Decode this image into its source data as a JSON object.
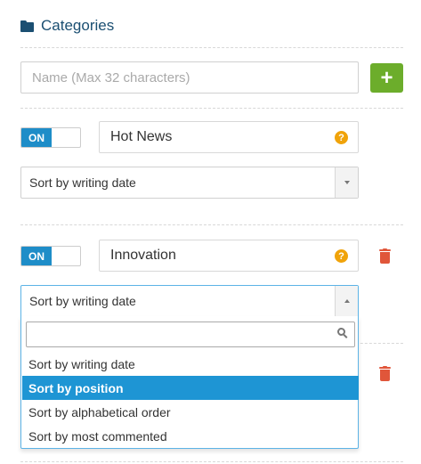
{
  "header": {
    "title": "Categories",
    "icon": "folder-icon"
  },
  "new_category": {
    "placeholder": "Name (Max 32 characters)",
    "add_label": "+"
  },
  "categories": [
    {
      "toggle": "ON",
      "name": "Hot News",
      "help": "?",
      "sort": "Sort by writing date"
    },
    {
      "toggle": "ON",
      "name": "Innovation",
      "help": "?",
      "sort": "Sort by writing date"
    }
  ],
  "dropdown": {
    "search_value": "",
    "options": [
      "Sort by writing date",
      "Sort by position",
      "Sort by alphabetical order",
      "Sort by most commented"
    ],
    "highlighted_index": 1
  },
  "colors": {
    "accent": "#1e8dc8",
    "add_button": "#6cad2b",
    "help_icon": "#f0a30a",
    "delete_icon": "#e0563a",
    "title": "#1b4f72"
  }
}
